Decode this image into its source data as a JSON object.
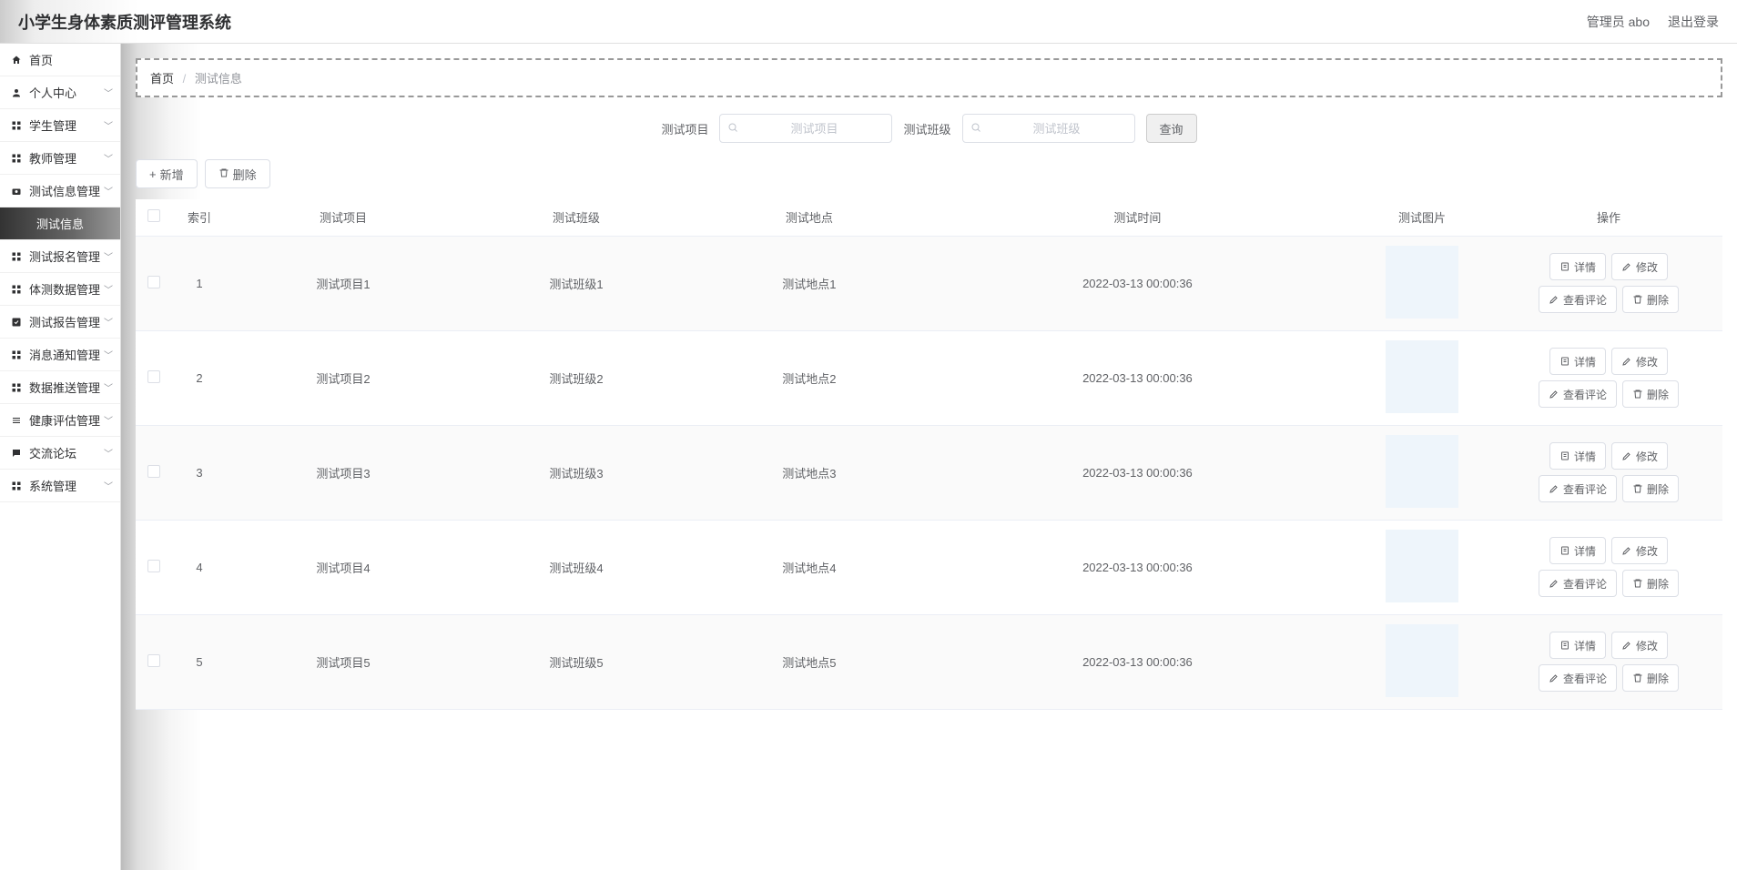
{
  "header": {
    "title": "小学生身体素质测评管理系统",
    "user_label": "管理员 abo",
    "logout_label": "退出登录"
  },
  "sidebar": {
    "items": [
      {
        "label": "首页",
        "icon": "home",
        "expandable": false
      },
      {
        "label": "个人中心",
        "icon": "user",
        "expandable": true
      },
      {
        "label": "学生管理",
        "icon": "grid",
        "expandable": true
      },
      {
        "label": "教师管理",
        "icon": "grid",
        "expandable": true
      },
      {
        "label": "测试信息管理",
        "icon": "camera",
        "expandable": true,
        "expanded": true
      },
      {
        "label": "测试信息",
        "icon": "",
        "sub": true,
        "active": true
      },
      {
        "label": "测试报名管理",
        "icon": "grid",
        "expandable": true
      },
      {
        "label": "体测数据管理",
        "icon": "grid",
        "expandable": true
      },
      {
        "label": "测试报告管理",
        "icon": "check",
        "expandable": true
      },
      {
        "label": "消息通知管理",
        "icon": "grid",
        "expandable": true
      },
      {
        "label": "数据推送管理",
        "icon": "grid",
        "expandable": true
      },
      {
        "label": "健康评估管理",
        "icon": "list",
        "expandable": true
      },
      {
        "label": "交流论坛",
        "icon": "chat",
        "expandable": true
      },
      {
        "label": "系统管理",
        "icon": "grid",
        "expandable": true
      }
    ]
  },
  "breadcrumb": {
    "home": "首页",
    "current": "测试信息"
  },
  "filter": {
    "project_label": "测试项目",
    "project_placeholder": "测试项目",
    "class_label": "测试班级",
    "class_placeholder": "测试班级",
    "query_label": "查询"
  },
  "actions": {
    "add_label": "新增",
    "delete_label": "删除"
  },
  "table": {
    "headers": {
      "index": "索引",
      "project": "测试项目",
      "class": "测试班级",
      "location": "测试地点",
      "time": "测试时间",
      "image": "测试图片",
      "ops": "操作"
    },
    "rows": [
      {
        "index": "1",
        "project": "测试项目1",
        "class": "测试班级1",
        "location": "测试地点1",
        "time": "2022-03-13 00:00:36"
      },
      {
        "index": "2",
        "project": "测试项目2",
        "class": "测试班级2",
        "location": "测试地点2",
        "time": "2022-03-13 00:00:36"
      },
      {
        "index": "3",
        "project": "测试项目3",
        "class": "测试班级3",
        "location": "测试地点3",
        "time": "2022-03-13 00:00:36"
      },
      {
        "index": "4",
        "project": "测试项目4",
        "class": "测试班级4",
        "location": "测试地点4",
        "time": "2022-03-13 00:00:36"
      },
      {
        "index": "5",
        "project": "测试项目5",
        "class": "测试班级5",
        "location": "测试地点5",
        "time": "2022-03-13 00:00:36"
      }
    ],
    "op_labels": {
      "detail": "详情",
      "edit": "修改",
      "comments": "查看评论",
      "delete": "删除"
    }
  }
}
